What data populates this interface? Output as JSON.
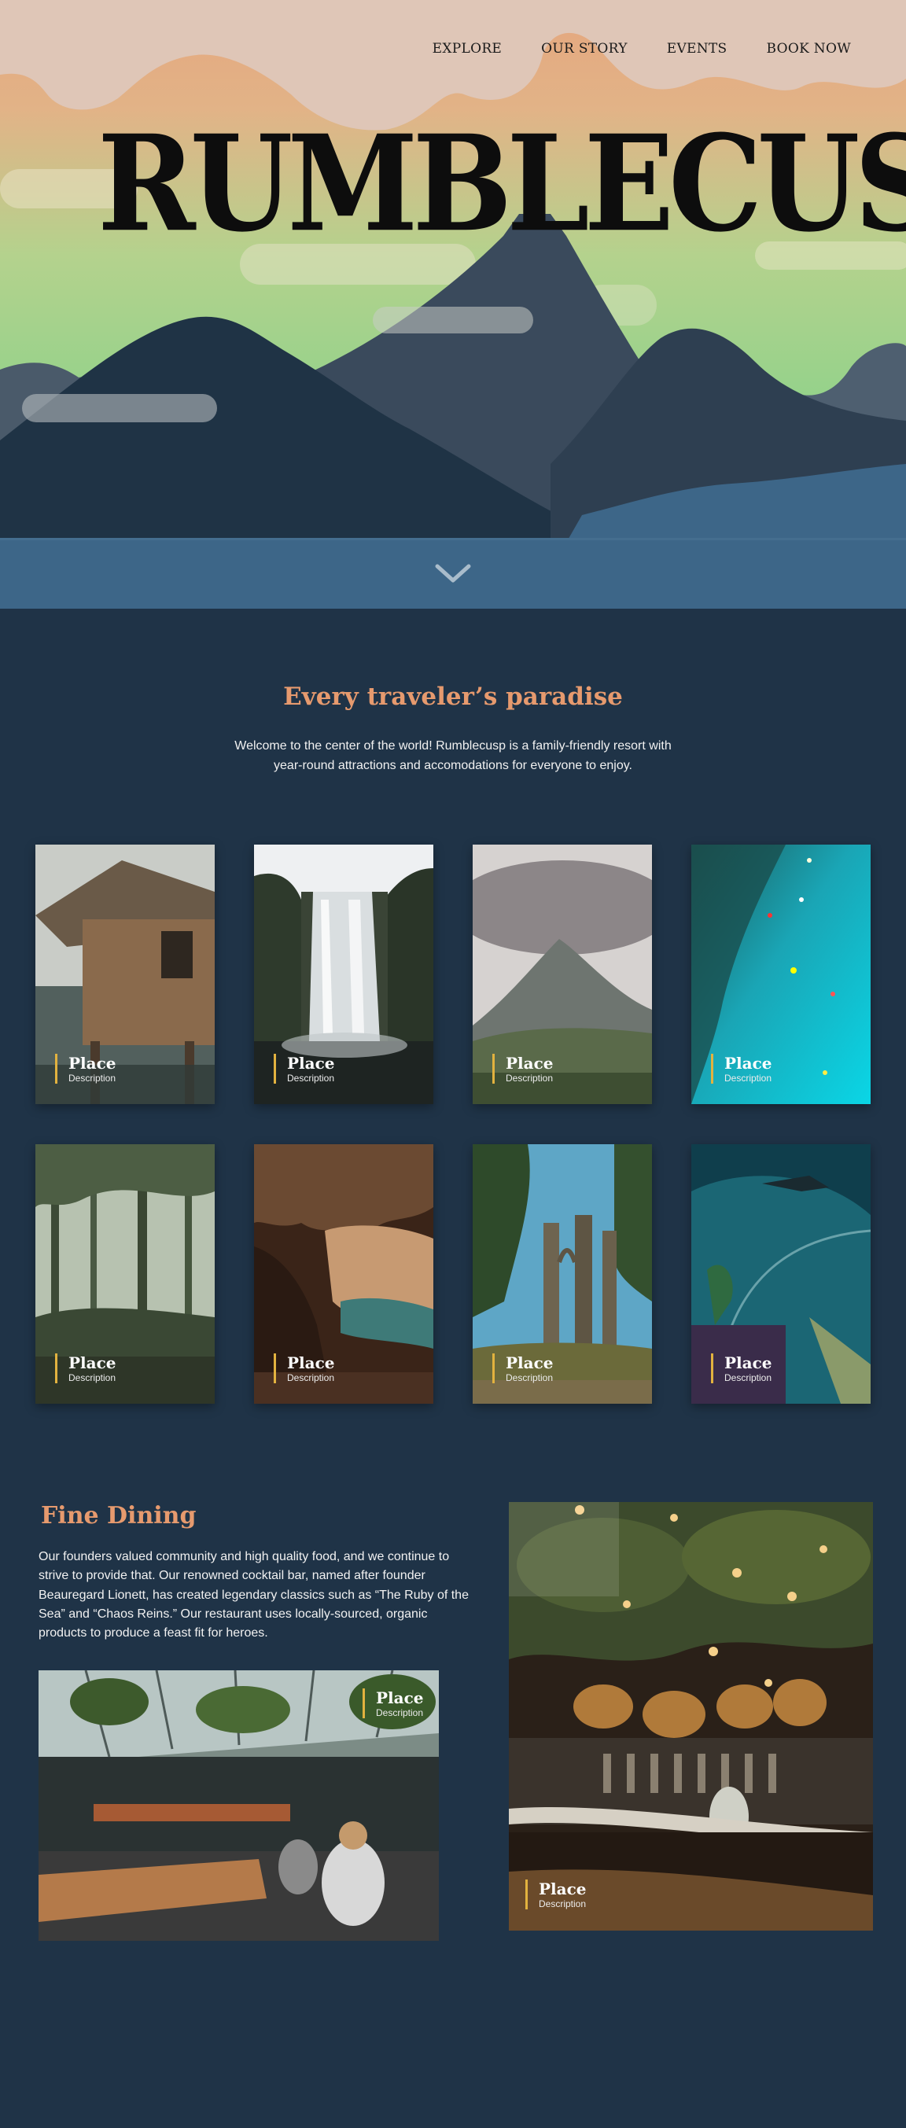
{
  "brand": {
    "title": "RUMBLECUSP"
  },
  "nav": {
    "items": [
      "EXPLORE",
      "OUR STORY",
      "EVENTS",
      "BOOK NOW"
    ]
  },
  "paradise": {
    "heading": "Every traveler’s paradise",
    "intro": "Welcome to the center of the world! Rumblecusp is a family-friendly resort with year-round attractions and accomodations for everyone to enjoy."
  },
  "cards": [
    {
      "place": "Place",
      "description": "Description",
      "image": "treehouse"
    },
    {
      "place": "Place",
      "description": "Description",
      "image": "waterfall"
    },
    {
      "place": "Place",
      "description": "Description",
      "image": "volcano"
    },
    {
      "place": "Place",
      "description": "Description",
      "image": "reef-swimmers"
    },
    {
      "place": "Place",
      "description": "Description",
      "image": "rainforest"
    },
    {
      "place": "Place",
      "description": "Description",
      "image": "cave"
    },
    {
      "place": "Place",
      "description": "Description",
      "image": "ruins"
    },
    {
      "place": "Place",
      "description": "Description",
      "image": "aquarium-tunnel"
    }
  ],
  "dining": {
    "heading": "Fine Dining",
    "text": "Our founders valued community and high quality food, and we continue to strive to provide that. Our renowned cocktail bar, named after founder Beauregard Lionett, has created legendary classics such as “The Ruby of the Sea” and “Chaos Reins.” Our restaurant uses locally-sourced, organic products to produce a feast fit for heroes.",
    "photos": [
      {
        "place": "Place",
        "description": "Description",
        "image": "greenhouse-restaurant"
      },
      {
        "place": "Place",
        "description": "Description",
        "image": "cocktail-bar"
      }
    ]
  },
  "colors": {
    "background": "#1f3347",
    "accent": "#e69a6e",
    "caption_bar": "#e2b23f",
    "water": "#3d6688"
  },
  "icons": {
    "scroll": "chevron-down-icon"
  }
}
